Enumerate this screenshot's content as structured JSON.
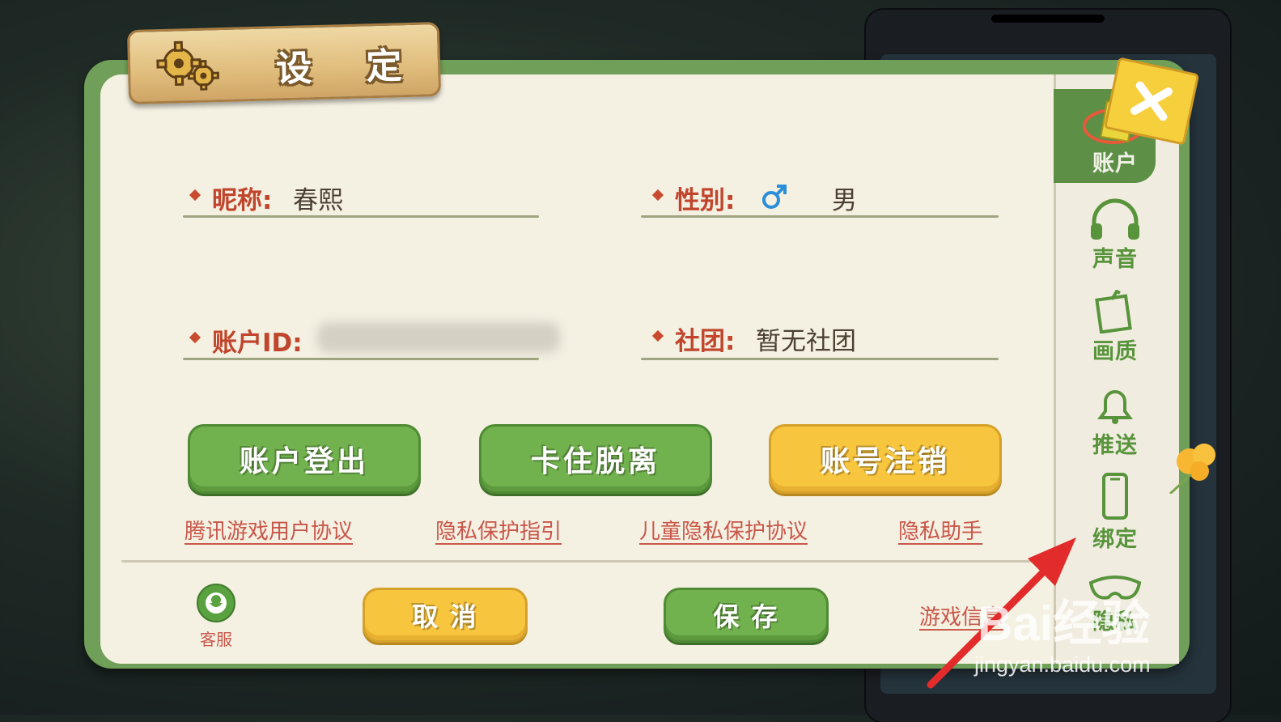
{
  "title": "设 定",
  "fields": {
    "nickname": {
      "label": "昵称:",
      "value": "春熙"
    },
    "gender": {
      "label": "性别:",
      "value": "男"
    },
    "account_id": {
      "label": "账户ID:",
      "value": ""
    },
    "club": {
      "label": "社团:",
      "value": "暂无社团"
    }
  },
  "buttons": {
    "logout": "账户登出",
    "unstuck": "卡住脱离",
    "deregister": "账号注销",
    "cancel": "取 消",
    "save": "保 存"
  },
  "links": {
    "user_agreement": "腾讯游戏用户协议",
    "privacy_guide": "隐私保护指引",
    "child_privacy": "儿童隐私保护协议",
    "privacy_assistant": "隐私助手",
    "game_info": "游戏信息"
  },
  "customer_service": "客服",
  "tabs": [
    {
      "label": "账户",
      "icon": "account-card-icon",
      "active": true
    },
    {
      "label": "声音",
      "icon": "headphones-icon"
    },
    {
      "label": "画质",
      "icon": "picture-quality-icon"
    },
    {
      "label": "推送",
      "icon": "bell-icon"
    },
    {
      "label": "绑定",
      "icon": "phone-icon"
    },
    {
      "label": "隐私",
      "icon": "mask-icon"
    }
  ],
  "watermark": {
    "logo": "Bai经验",
    "url": "jingyan.baidu.com"
  },
  "colors": {
    "frame_green": "#6f9f58",
    "label_red": "#c0452c",
    "button_green": "#72b24e",
    "button_yellow": "#f8c53e",
    "arrow_red": "#e22b2b"
  }
}
